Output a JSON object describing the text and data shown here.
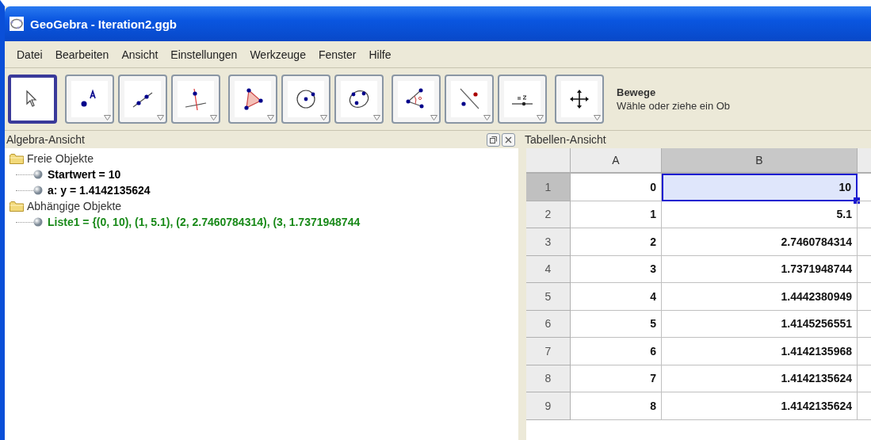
{
  "window": {
    "title": "GeoGebra - Iteration2.ggb"
  },
  "menu": [
    "Datei",
    "Bearbeiten",
    "Ansicht",
    "Einstellungen",
    "Werkzeuge",
    "Fenster",
    "Hilfe"
  ],
  "toolbar": {
    "groups": [
      [
        {
          "kind": "move",
          "selected": true
        }
      ],
      [
        {
          "kind": "point",
          "selected": false
        },
        {
          "kind": "line",
          "selected": false
        },
        {
          "kind": "perpendicular",
          "selected": false
        }
      ],
      [
        {
          "kind": "polygon",
          "selected": false
        },
        {
          "kind": "circle",
          "selected": false
        },
        {
          "kind": "conic",
          "selected": false
        }
      ],
      [
        {
          "kind": "angle",
          "selected": false
        },
        {
          "kind": "reflect",
          "selected": false
        },
        {
          "kind": "slider",
          "selected": false
        }
      ],
      [
        {
          "kind": "pan",
          "selected": false
        }
      ]
    ],
    "tool_name": "Bewege",
    "tool_help": "Wähle oder ziehe ein Ob"
  },
  "algebra_view": {
    "title": "Algebra-Ansicht",
    "tree": [
      {
        "label": "Freie Objekte",
        "children": [
          {
            "label": "Startwert = 10",
            "color": "#000000"
          },
          {
            "label": "a: y = 1.4142135624",
            "color": "#000000"
          }
        ]
      },
      {
        "label": "Abhängige Objekte",
        "children": [
          {
            "label": "Liste1 = {(0, 10), (1, 5.1), (2, 2.7460784314), (3, 1.7371948744",
            "color": "#1a8a1a"
          }
        ]
      }
    ]
  },
  "table_view": {
    "title": "Tabellen-Ansicht",
    "columns": [
      {
        "label": "A",
        "selected": false
      },
      {
        "label": "B",
        "selected": true
      },
      {
        "selected": false
      }
    ],
    "rows": [
      {
        "label": "1",
        "selected": true,
        "cells": [
          {
            "value": "0",
            "selected": false
          },
          {
            "value": "10",
            "selected": true
          }
        ]
      },
      {
        "label": "2",
        "selected": false,
        "cells": [
          {
            "value": "1",
            "selected": false
          },
          {
            "value": "5.1",
            "selected": false
          }
        ]
      },
      {
        "label": "3",
        "selected": false,
        "cells": [
          {
            "value": "2",
            "selected": false
          },
          {
            "value": "2.7460784314",
            "selected": false
          }
        ]
      },
      {
        "label": "4",
        "selected": false,
        "cells": [
          {
            "value": "3",
            "selected": false
          },
          {
            "value": "1.7371948744",
            "selected": false
          }
        ]
      },
      {
        "label": "5",
        "selected": false,
        "cells": [
          {
            "value": "4",
            "selected": false
          },
          {
            "value": "1.4442380949",
            "selected": false
          }
        ]
      },
      {
        "label": "6",
        "selected": false,
        "cells": [
          {
            "value": "5",
            "selected": false
          },
          {
            "value": "1.4145256551",
            "selected": false
          }
        ]
      },
      {
        "label": "7",
        "selected": false,
        "cells": [
          {
            "value": "6",
            "selected": false
          },
          {
            "value": "1.4142135968",
            "selected": false
          }
        ]
      },
      {
        "label": "8",
        "selected": false,
        "cells": [
          {
            "value": "7",
            "selected": false
          },
          {
            "value": "1.4142135624",
            "selected": false
          }
        ]
      },
      {
        "label": "9",
        "selected": false,
        "cells": [
          {
            "value": "8",
            "selected": false
          },
          {
            "value": "1.4142135624",
            "selected": false
          }
        ]
      }
    ]
  }
}
